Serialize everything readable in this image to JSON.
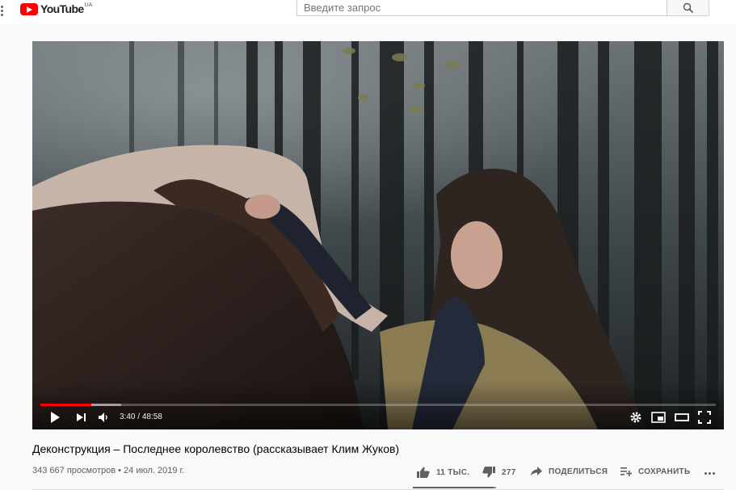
{
  "header": {
    "logo_text": "YouTube",
    "country_code": "UA",
    "search_placeholder": "Введите запрос",
    "search_value": ""
  },
  "player": {
    "current_time": "3:40",
    "duration": "48:58",
    "time_separator": " / ",
    "progress_played_fraction": 0.0749,
    "progress_buffered_fraction": 0.1196
  },
  "video": {
    "title": "Деконструкция – Последнее королевство (рассказывает Клим Жуков)",
    "views": "343 667 просмотров",
    "meta_separator": " • ",
    "date": "24 июл. 2019 г."
  },
  "actions": {
    "likes": "11 ТЫС.",
    "dislikes": "277",
    "share_label": "ПОДЕЛИТЬСЯ",
    "save_label": "СОХРАНИТЬ",
    "like_ratio": 0.975
  },
  "colors": {
    "brand_red": "#ff0000",
    "text_secondary": "#606060"
  }
}
